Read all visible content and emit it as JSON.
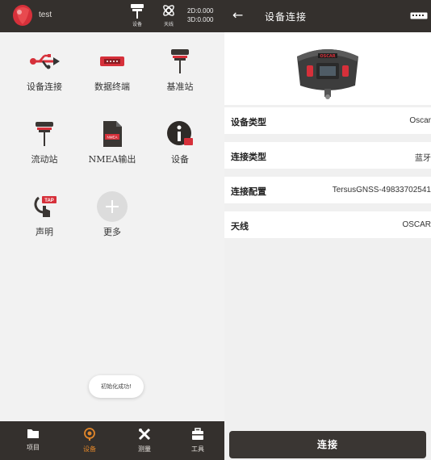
{
  "left": {
    "topbar": {
      "project_name": "test",
      "device_caption": "设备",
      "sky_caption": "天线",
      "coord_2d": "2D:0.000",
      "coord_3d": "3D:0.000"
    },
    "tiles": [
      {
        "label": "设备连接",
        "icon": "usb-icon"
      },
      {
        "label": "数据终端",
        "icon": "data-terminal-icon"
      },
      {
        "label": "基准站",
        "icon": "base-station-icon"
      },
      {
        "label": "流动站",
        "icon": "rover-icon"
      },
      {
        "label": "NMEA输出",
        "icon": "nmea-document-icon"
      },
      {
        "label": "设备",
        "icon": "device-info-icon"
      },
      {
        "label": "声明",
        "icon": "tap-icon"
      },
      {
        "label": "更多",
        "icon": "plus-icon"
      }
    ],
    "toast": "初始化成功!",
    "nav": [
      {
        "label": "项目",
        "icon": "folder-icon"
      },
      {
        "label": "设备",
        "icon": "device-icon"
      },
      {
        "label": "测量",
        "icon": "survey-icon"
      },
      {
        "label": "工具",
        "icon": "toolbox-icon"
      }
    ],
    "active_color": "#e1862a"
  },
  "right": {
    "title": "设备连接",
    "device_brand": "OSCAR",
    "rows": [
      {
        "key": "设备类型",
        "value": "Oscar"
      },
      {
        "key": "连接类型",
        "value": "蓝牙"
      },
      {
        "key": "连接配置",
        "value": "TersusGNSS-49833702541"
      },
      {
        "key": "天线",
        "value": "OSCAR"
      }
    ],
    "connect_label": "连接"
  },
  "colors": {
    "bar": "#34302d",
    "accent": "#e1862a",
    "brand_red": "#d6303a"
  }
}
